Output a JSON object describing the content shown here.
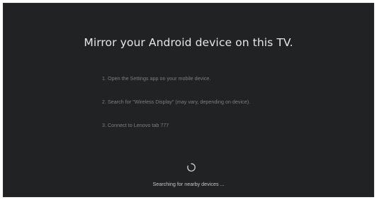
{
  "screen": {
    "title": "Mirror your Android device on this TV.",
    "steps": [
      "1. Open the Settings app on your mobile device.",
      "2. Search for \"Wireless Display\" (may vary, depending on device).",
      "3. Connect to Lenovo tab 777"
    ],
    "status": "Searching for nearby devices ..."
  },
  "colors": {
    "background": "#202224",
    "title": "#e6e7e8",
    "steps": "#7c7f83",
    "status": "#c4c6c9"
  },
  "icons": {
    "spinner": "loading-spinner-icon"
  }
}
